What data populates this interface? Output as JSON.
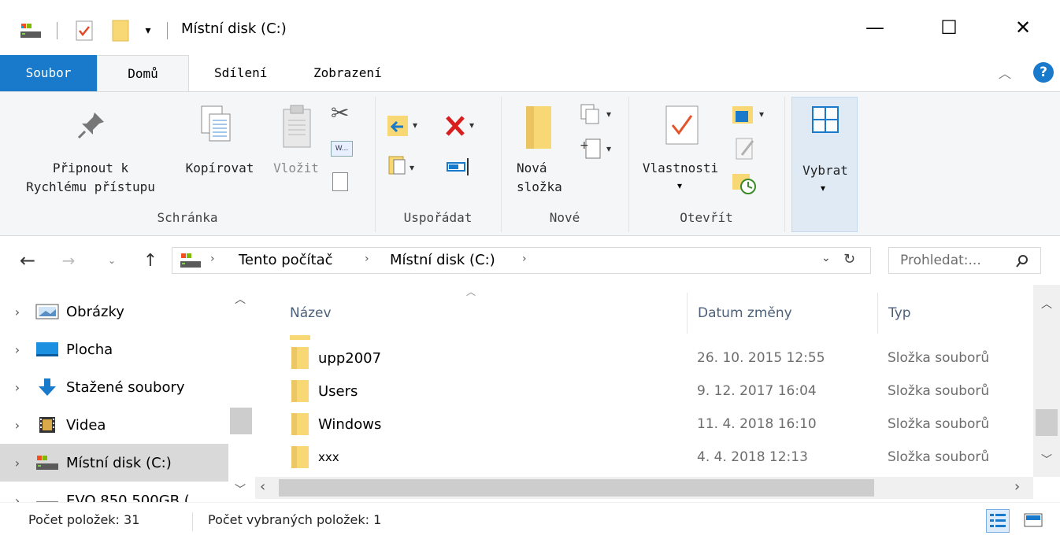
{
  "window": {
    "title": "Místní disk (C:)",
    "minimize_glyph": "—",
    "maximize_glyph": "☐",
    "close_glyph": "✕"
  },
  "ribbon_tabs": [
    {
      "label": "Soubor"
    },
    {
      "label": "Domů"
    },
    {
      "label": "Sdílení"
    },
    {
      "label": "Zobrazení"
    }
  ],
  "ribbon": {
    "clipboard": {
      "pin_line1": "Připnout k",
      "pin_line2": "Rychlému přístupu",
      "copy": "Kopírovat",
      "paste": "Vložit",
      "group": "Schránka"
    },
    "organize": {
      "group": "Uspořádat"
    },
    "new": {
      "folder_line1": "Nová",
      "folder_line2": "složka",
      "group": "Nové"
    },
    "open": {
      "properties": "Vlastnosti",
      "group": "Otevřít"
    },
    "select": {
      "label": "Vybrat"
    }
  },
  "address": {
    "crumbs": [
      "Tento počítač",
      "Místní disk (C:)"
    ],
    "search_placeholder": "Prohledat:..."
  },
  "nav_pane": [
    {
      "label": "Obrázky",
      "icon": "pictures-icon"
    },
    {
      "label": "Plocha",
      "icon": "desktop-icon"
    },
    {
      "label": "Stažené soubory",
      "icon": "downloads-icon"
    },
    {
      "label": "Videa",
      "icon": "videos-icon"
    },
    {
      "label": "Místní disk (C:)",
      "icon": "drive-icon",
      "selected": true
    },
    {
      "label": "EVO 850 500GB (",
      "icon": "drive-icon"
    }
  ],
  "columns": {
    "name": "Název",
    "date": "Datum změny",
    "type": "Typ"
  },
  "files": [
    {
      "name": "upp2007",
      "date": "26. 10. 2015 12:55",
      "type": "Složka souborů"
    },
    {
      "name": "Users",
      "date": "9. 12. 2017 16:04",
      "type": "Složka souborů"
    },
    {
      "name": "Windows",
      "date": "11. 4. 2018 16:10",
      "type": "Složka souborů"
    },
    {
      "name": "xxx",
      "date": "4. 4. 2018 12:13",
      "type": "Složka souborů"
    }
  ],
  "status": {
    "item_count": "Počet položek: 31",
    "selected_count": "Počet vybraných položek: 1"
  },
  "colors": {
    "file_tab": "#1979ca",
    "folder": "#f8d775",
    "help": "#1979ca"
  }
}
